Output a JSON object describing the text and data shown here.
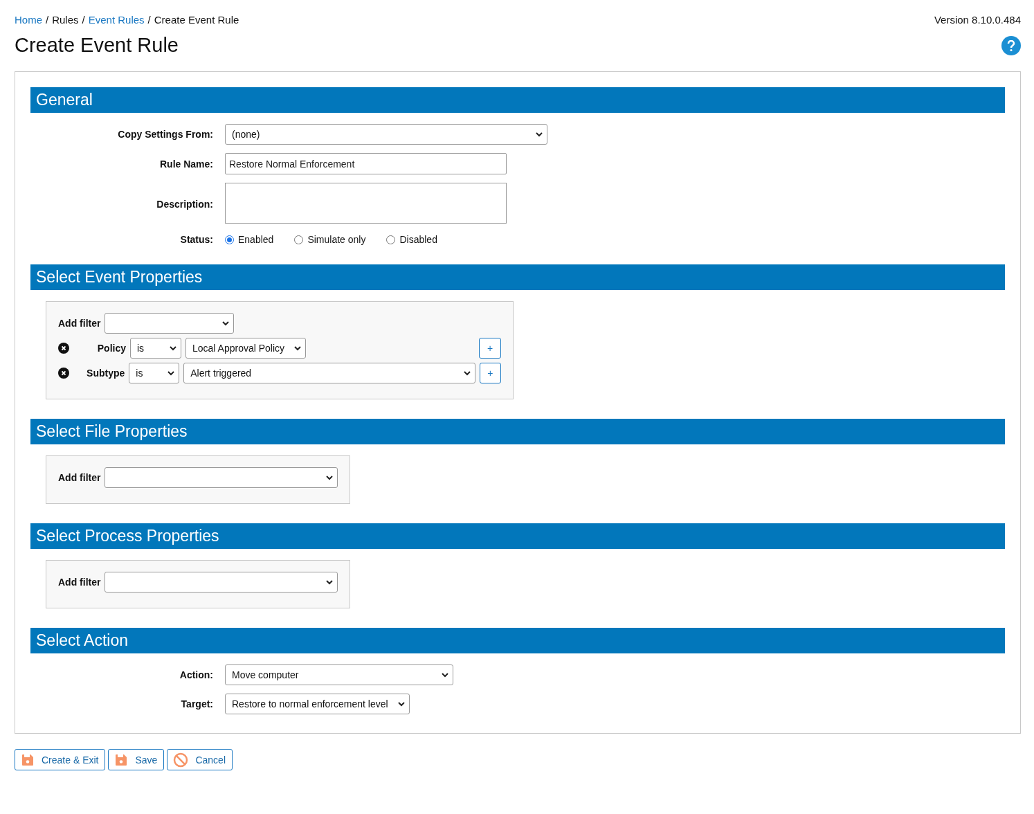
{
  "breadcrumb": [
    {
      "label": "Home",
      "link": true
    },
    {
      "separator": "/",
      "label": "Rules",
      "link": false
    },
    {
      "separator": "/",
      "label": "Event Rules",
      "link": true
    },
    {
      "separator": "/",
      "label": "Create Event Rule",
      "link": false
    }
  ],
  "version": "Version 8.10.0.484",
  "title": "Create Event Rule",
  "sections": [
    {
      "kind": "form",
      "title": "General",
      "fields": [
        {
          "kind": "select",
          "label": "Copy Settings From:",
          "value": "(none)"
        },
        {
          "kind": "text",
          "label": "Rule Name:",
          "value": "Restore Normal Enforcement"
        },
        {
          "kind": "textarea",
          "label": "Description:"
        },
        {
          "kind": "radio",
          "label": "Status:",
          "options": [
            {
              "label": "Enabled",
              "selected": true
            },
            {
              "label": "Simulate only",
              "selected": false
            },
            {
              "label": "Disabled",
              "selected": false
            }
          ]
        }
      ]
    },
    {
      "kind": "filters",
      "title": "Select Event Properties",
      "add_filter": "Add filter",
      "filters": [
        {
          "name": "Policy",
          "operator": "is",
          "value": "Local Approval Policy",
          "add": "+"
        },
        {
          "name": "Subtype",
          "operator": "is",
          "value": "Alert triggered",
          "add": "+"
        }
      ]
    },
    {
      "kind": "filters",
      "title": "Select File Properties",
      "add_filter": "Add filter"
    },
    {
      "kind": "filters",
      "title": "Select Process Properties",
      "add_filter": "Add filter"
    },
    {
      "kind": "form",
      "title": "Select Action",
      "fields": [
        {
          "kind": "select",
          "label": "Action:",
          "value": "Move computer"
        },
        {
          "kind": "select",
          "label": "Target:",
          "value": "Restore to normal enforcement level"
        }
      ]
    }
  ],
  "buttons": [
    {
      "kind": "save",
      "label": "Create & Exit"
    },
    {
      "kind": "save",
      "label": "Save"
    },
    {
      "kind": "cancel",
      "label": "Cancel"
    }
  ]
}
